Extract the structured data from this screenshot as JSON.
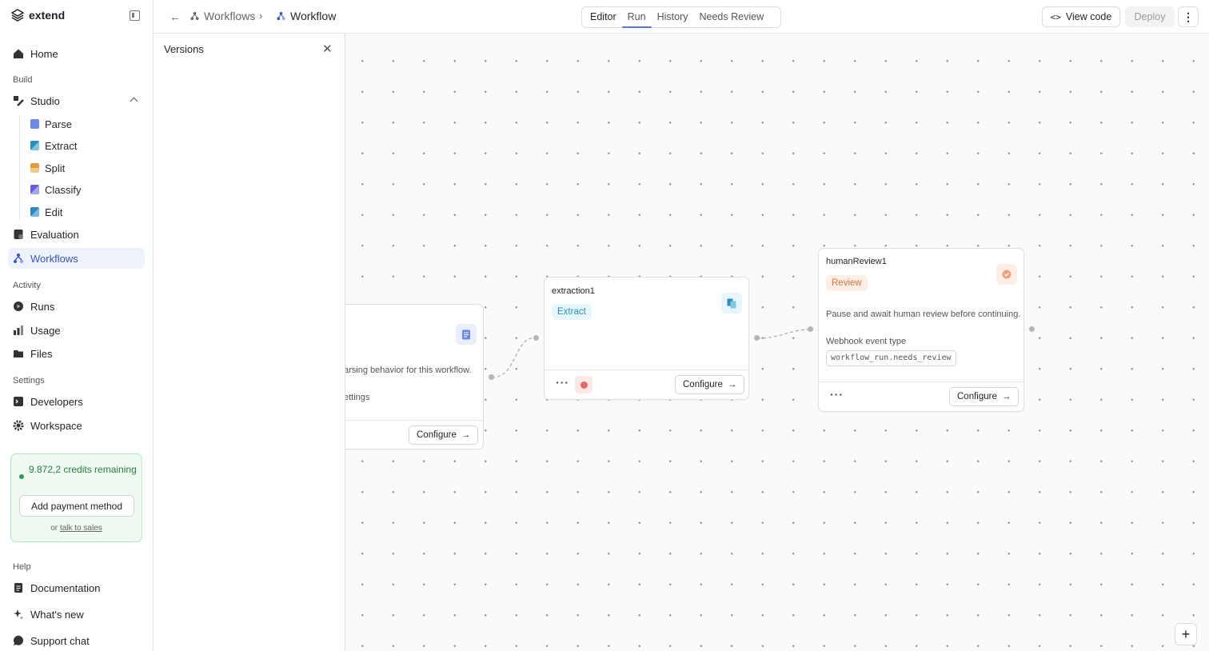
{
  "app": {
    "brand": "extend"
  },
  "sidebar": {
    "home": "Home",
    "section_build": "Build",
    "studio": "Studio",
    "studio_items": [
      "Parse",
      "Extract",
      "Split",
      "Classify",
      "Edit"
    ],
    "evaluation": "Evaluation",
    "workflows": "Workflows",
    "section_activity": "Activity",
    "runs": "Runs",
    "usage": "Usage",
    "files": "Files",
    "section_settings": "Settings",
    "developers": "Developers",
    "workspace": "Workspace",
    "credits_text": "9.872,2 credits remaining",
    "add_payment": "Add payment method",
    "or_text": "or",
    "talk_to_sales": "talk to sales",
    "section_help": "Help",
    "documentation": "Documentation",
    "whats_new": "What's new",
    "support_chat": "Support chat"
  },
  "topbar": {
    "crumb_workflows": "Workflows",
    "crumb_workflow": "Workflow",
    "tabs": [
      "Editor",
      "Run",
      "History",
      "Needs Review"
    ],
    "view_code": "View code",
    "deploy": "Deploy"
  },
  "versions_panel": {
    "title": "Versions"
  },
  "nodes": {
    "parse": {
      "description": "arsing behavior for this workflow.",
      "settings_fragment": "ettings",
      "configure": "Configure"
    },
    "extraction": {
      "name": "extraction1",
      "badge": "Extract",
      "configure": "Configure"
    },
    "review": {
      "name": "humanReview1",
      "badge": "Review",
      "description": "Pause and await human review before continuing.",
      "webhook_label": "Webhook event type",
      "webhook_value": "workflow_run.needs_review",
      "configure": "Configure"
    }
  },
  "colors": {
    "accent": "#3855b8",
    "extract_badge": "#e6f6fb",
    "review_badge": "#fdeee6",
    "credits_green": "#2a7d44"
  }
}
